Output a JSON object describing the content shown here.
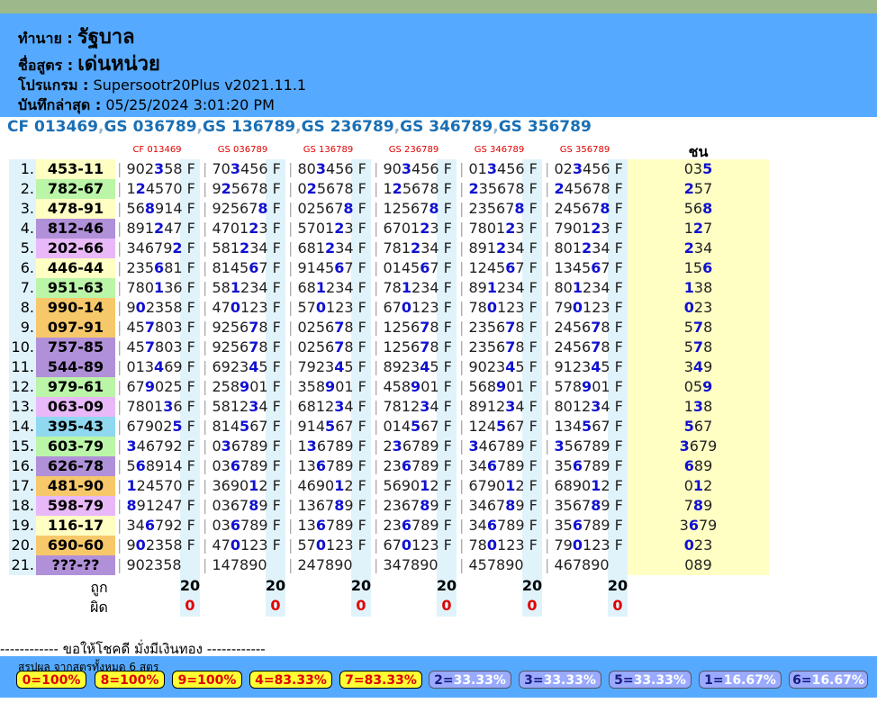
{
  "header": {
    "label1": "ทำนาย :",
    "value1": "รัฐบาล",
    "label2": "ชื่อสูตร :",
    "value2": "เด่นหน่วย",
    "label3": "โปรแกรม :",
    "value3": "Supersootr20Plus v2021.11.1",
    "label4": "บันทึกล่าสุด :",
    "value4": "05/25/2024 3:01:20 PM"
  },
  "formulas": [
    "CF 013469",
    "GS 036789",
    "GS 136789",
    "GS 236789",
    "GS 346789",
    "GS 356789"
  ],
  "chon_header": "ชน",
  "rows": [
    {
      "n": "1.",
      "result": "453-11",
      "color": "#ffffc4",
      "cells": [
        "902358 F",
        "703456 F",
        "803456 F",
        "903456 F",
        "013456 F",
        "023456 F"
      ],
      "hl": [
        "3",
        "3",
        "3",
        "3",
        "3",
        "3"
      ],
      "chon": "035",
      "chon_hl": [
        "5"
      ]
    },
    {
      "n": "2.",
      "result": "782-67",
      "color": "#bbf5a8",
      "cells": [
        "124570 F",
        "925678 F",
        "025678 F",
        "125678 F",
        "235678 F",
        "245678 F"
      ],
      "hl": [
        "2",
        "2",
        "2",
        "2",
        "2",
        "2"
      ],
      "chon": "257",
      "chon_hl": [
        "2"
      ]
    },
    {
      "n": "3.",
      "result": "478-91",
      "color": "#ffffc4",
      "cells": [
        "568914 F",
        "925678 F",
        "025678 F",
        "125678 F",
        "235678 F",
        "245678 F"
      ],
      "hl": [
        "8",
        "8",
        "8",
        "8",
        "8",
        "8"
      ],
      "chon": "568",
      "chon_hl": [
        "8"
      ]
    },
    {
      "n": "4.",
      "result": "812-46",
      "color": "#b090d8",
      "cells": [
        "891247 F",
        "470123 F",
        "570123 F",
        "670123 F",
        "780123 F",
        "790123 F"
      ],
      "hl": [
        "2",
        "2",
        "2",
        "2",
        "2",
        "2"
      ],
      "chon": "127",
      "chon_hl": [
        "2"
      ]
    },
    {
      "n": "5.",
      "result": "202-66",
      "color": "#e8b8f8",
      "cells": [
        "346792 F",
        "581234 F",
        "681234 F",
        "781234 F",
        "891234 F",
        "801234 F"
      ],
      "hl": [
        "2",
        "2",
        "2",
        "2",
        "2",
        "2"
      ],
      "chon": "234",
      "chon_hl": [
        "2"
      ]
    },
    {
      "n": "6.",
      "result": "446-44",
      "color": "#ffffc4",
      "cells": [
        "235681 F",
        "814567 F",
        "914567 F",
        "014567 F",
        "124567 F",
        "134567 F"
      ],
      "hl": [
        "6",
        "6",
        "6",
        "6",
        "6",
        "6"
      ],
      "chon": "156",
      "chon_hl": [
        "6"
      ]
    },
    {
      "n": "7.",
      "result": "951-63",
      "color": "#bbf5a8",
      "cells": [
        "780136 F",
        "581234 F",
        "681234 F",
        "781234 F",
        "891234 F",
        "801234 F"
      ],
      "hl": [
        "1",
        "1",
        "1",
        "1",
        "1",
        "1"
      ],
      "chon": "138",
      "chon_hl": [
        "1"
      ]
    },
    {
      "n": "8.",
      "result": "990-14",
      "color": "#f7c86a",
      "cells": [
        "902358 F",
        "470123 F",
        "570123 F",
        "670123 F",
        "780123 F",
        "790123 F"
      ],
      "hl": [
        "0",
        "0",
        "0",
        "0",
        "0",
        "0"
      ],
      "chon": "023",
      "chon_hl": [
        "0"
      ]
    },
    {
      "n": "9.",
      "result": "097-91",
      "color": "#f7c86a",
      "cells": [
        "457803 F",
        "925678 F",
        "025678 F",
        "125678 F",
        "235678 F",
        "245678 F"
      ],
      "hl": [
        "7",
        "7",
        "7",
        "7",
        "7",
        "7"
      ],
      "chon": "578",
      "chon_hl": [
        "7"
      ]
    },
    {
      "n": "10.",
      "result": "757-85",
      "color": "#b090d8",
      "cells": [
        "457803 F",
        "925678 F",
        "025678 F",
        "125678 F",
        "235678 F",
        "245678 F"
      ],
      "hl": [
        "7",
        "7",
        "7",
        "7",
        "7",
        "7"
      ],
      "chon": "578",
      "chon_hl": [
        "7"
      ]
    },
    {
      "n": "11.",
      "result": "544-89",
      "color": "#b090d8",
      "cells": [
        "013469 F",
        "692345 F",
        "792345 F",
        "892345 F",
        "902345 F",
        "912345 F"
      ],
      "hl": [
        "4",
        "4",
        "4",
        "4",
        "4",
        "4"
      ],
      "chon": "349",
      "chon_hl": [
        "4"
      ]
    },
    {
      "n": "12.",
      "result": "979-61",
      "color": "#bbf5a8",
      "cells": [
        "679025 F",
        "258901 F",
        "358901 F",
        "458901 F",
        "568901 F",
        "578901 F"
      ],
      "hl": [
        "9",
        "9",
        "9",
        "9",
        "9",
        "9"
      ],
      "chon": "059",
      "chon_hl": [
        "9"
      ]
    },
    {
      "n": "13.",
      "result": "063-09",
      "color": "#e8b8f8",
      "cells": [
        "780136 F",
        "581234 F",
        "681234 F",
        "781234 F",
        "891234 F",
        "801234 F"
      ],
      "hl": [
        "3",
        "3",
        "3",
        "3",
        "3",
        "3"
      ],
      "chon": "138",
      "chon_hl": [
        "3"
      ]
    },
    {
      "n": "14.",
      "result": "395-43",
      "color": "#8fd8f0",
      "cells": [
        "679025 F",
        "814567 F",
        "914567 F",
        "014567 F",
        "124567 F",
        "134567 F"
      ],
      "hl": [
        "5",
        "5",
        "5",
        "5",
        "5",
        "5"
      ],
      "chon": "567",
      "chon_hl": [
        "5"
      ]
    },
    {
      "n": "15.",
      "result": "603-79",
      "color": "#bbf5a8",
      "cells": [
        "346792 F",
        "036789 F",
        "136789 F",
        "236789 F",
        "346789 F",
        "356789 F"
      ],
      "hl": [
        "3",
        "3",
        "3",
        "3",
        "3",
        "3"
      ],
      "chon": "3679",
      "chon_hl": [
        "3"
      ]
    },
    {
      "n": "16.",
      "result": "626-78",
      "color": "#b090d8",
      "cells": [
        "568914 F",
        "036789 F",
        "136789 F",
        "236789 F",
        "346789 F",
        "356789 F"
      ],
      "hl": [
        "6",
        "6",
        "6",
        "6",
        "6",
        "6"
      ],
      "chon": "689",
      "chon_hl": [
        "6"
      ]
    },
    {
      "n": "17.",
      "result": "481-90",
      "color": "#f7c86a",
      "cells": [
        "124570 F",
        "369012 F",
        "469012 F",
        "569012 F",
        "679012 F",
        "689012 F"
      ],
      "hl": [
        "1",
        "1",
        "1",
        "1",
        "1",
        "1"
      ],
      "chon": "012",
      "chon_hl": [
        "1"
      ]
    },
    {
      "n": "18.",
      "result": "598-79",
      "color": "#e8b8f8",
      "cells": [
        "891247 F",
        "036789 F",
        "136789 F",
        "236789 F",
        "346789 F",
        "356789 F"
      ],
      "hl": [
        "8",
        "8",
        "8",
        "8",
        "8",
        "8"
      ],
      "chon": "789",
      "chon_hl": [
        "8"
      ]
    },
    {
      "n": "19.",
      "result": "116-17",
      "color": "#ffffc4",
      "cells": [
        "346792 F",
        "036789 F",
        "136789 F",
        "236789 F",
        "346789 F",
        "356789 F"
      ],
      "hl": [
        "6",
        "6",
        "6",
        "6",
        "6",
        "6"
      ],
      "chon": "3679",
      "chon_hl": [
        "6"
      ]
    },
    {
      "n": "20.",
      "result": "690-60",
      "color": "#f7c86a",
      "cells": [
        "902358 F",
        "470123 F",
        "570123 F",
        "670123 F",
        "780123 F",
        "790123 F"
      ],
      "hl": [
        "0",
        "0",
        "0",
        "0",
        "0",
        "0"
      ],
      "chon": "023",
      "chon_hl": [
        "0"
      ]
    },
    {
      "n": "21.",
      "result": "???-??",
      "color": "#b090d8",
      "cells": [
        "902358",
        "147890",
        "247890",
        "347890",
        "457890",
        "467890"
      ],
      "hl": [
        "",
        "",
        "",
        "",
        "",
        ""
      ],
      "chon": "089",
      "chon_hl": []
    }
  ],
  "tally": {
    "correct_label": "ถูก",
    "wrong_label": "ผิด",
    "correct": [
      "20",
      "20",
      "20",
      "20",
      "20",
      "20"
    ],
    "wrong": [
      "0",
      "0",
      "0",
      "0",
      "0",
      "0"
    ]
  },
  "blessing": "------------ ขอให้โชคดี มั่งมีเงินทอง ------------",
  "summary": {
    "label": "สรุปผล จากสูตรทั้งหมด 6 สูตร",
    "badges": [
      {
        "k": "0",
        "v": "100%",
        "hi": true
      },
      {
        "k": "8",
        "v": "100%",
        "hi": true
      },
      {
        "k": "9",
        "v": "100%",
        "hi": true
      },
      {
        "k": "4",
        "v": "83.33%",
        "hi": true
      },
      {
        "k": "7",
        "v": "83.33%",
        "hi": true
      },
      {
        "k": "2",
        "v": "33.33%",
        "hi": false
      },
      {
        "k": "3",
        "v": "33.33%",
        "hi": false
      },
      {
        "k": "5",
        "v": "33.33%",
        "hi": false
      },
      {
        "k": "1",
        "v": "16.67%",
        "hi": false
      },
      {
        "k": "6",
        "v": "16.67%",
        "hi": false
      }
    ]
  }
}
